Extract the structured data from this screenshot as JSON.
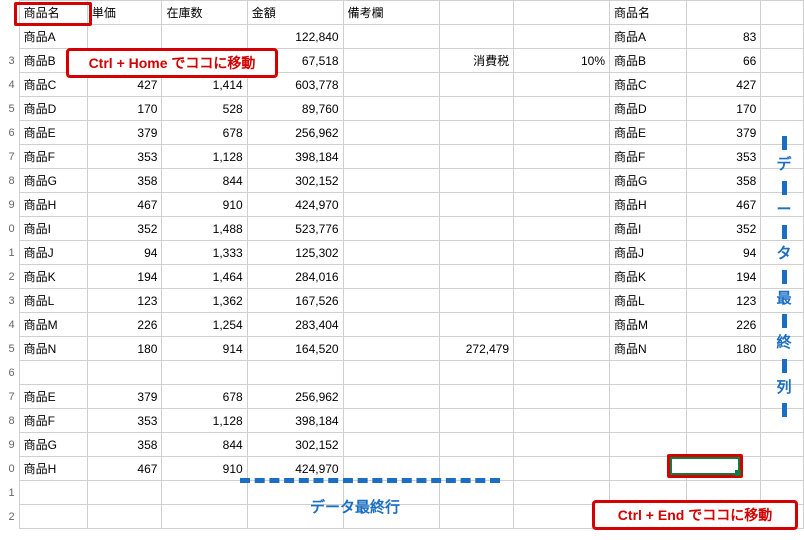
{
  "headers": {
    "name": "商品名",
    "price": "単価",
    "stock": "在庫数",
    "amount": "金額",
    "note": "備考欄",
    "name2": "商品名"
  },
  "rows": [
    {
      "rn": "",
      "name": "商品A",
      "price": "",
      "stock": "",
      "amount": "122,840",
      "note": "",
      "f": "",
      "g": "",
      "name2": "商品A",
      "val": "83"
    },
    {
      "rn": "3",
      "name": "商品B",
      "price": "",
      "stock": "",
      "amount": "67,518",
      "note": "",
      "f": "消費税",
      "g": "10%",
      "name2": "商品B",
      "val": "66"
    },
    {
      "rn": "4",
      "name": "商品C",
      "price": "427",
      "stock": "1,414",
      "amount": "603,778",
      "note": "",
      "f": "",
      "g": "",
      "name2": "商品C",
      "val": "427"
    },
    {
      "rn": "5",
      "name": "商品D",
      "price": "170",
      "stock": "528",
      "amount": "89,760",
      "note": "",
      "f": "",
      "g": "",
      "name2": "商品D",
      "val": "170"
    },
    {
      "rn": "6",
      "name": "商品E",
      "price": "379",
      "stock": "678",
      "amount": "256,962",
      "note": "",
      "f": "",
      "g": "",
      "name2": "商品E",
      "val": "379"
    },
    {
      "rn": "7",
      "name": "商品F",
      "price": "353",
      "stock": "1,128",
      "amount": "398,184",
      "note": "",
      "f": "",
      "g": "",
      "name2": "商品F",
      "val": "353"
    },
    {
      "rn": "8",
      "name": "商品G",
      "price": "358",
      "stock": "844",
      "amount": "302,152",
      "note": "",
      "f": "",
      "g": "",
      "name2": "商品G",
      "val": "358"
    },
    {
      "rn": "9",
      "name": "商品H",
      "price": "467",
      "stock": "910",
      "amount": "424,970",
      "note": "",
      "f": "",
      "g": "",
      "name2": "商品H",
      "val": "467"
    },
    {
      "rn": "0",
      "name": "商品I",
      "price": "352",
      "stock": "1,488",
      "amount": "523,776",
      "note": "",
      "f": "",
      "g": "",
      "name2": "商品I",
      "val": "352"
    },
    {
      "rn": "1",
      "name": "商品J",
      "price": "94",
      "stock": "1,333",
      "amount": "125,302",
      "note": "",
      "f": "",
      "g": "",
      "name2": "商品J",
      "val": "94"
    },
    {
      "rn": "2",
      "name": "商品K",
      "price": "194",
      "stock": "1,464",
      "amount": "284,016",
      "note": "",
      "f": "",
      "g": "",
      "name2": "商品K",
      "val": "194"
    },
    {
      "rn": "3",
      "name": "商品L",
      "price": "123",
      "stock": "1,362",
      "amount": "167,526",
      "note": "",
      "f": "",
      "g": "",
      "name2": "商品L",
      "val": "123"
    },
    {
      "rn": "4",
      "name": "商品M",
      "price": "226",
      "stock": "1,254",
      "amount": "283,404",
      "note": "",
      "f": "",
      "g": "",
      "name2": "商品M",
      "val": "226"
    },
    {
      "rn": "5",
      "name": "商品N",
      "price": "180",
      "stock": "914",
      "amount": "164,520",
      "note": "",
      "f": "272,479",
      "g": "",
      "name2": "商品N",
      "val": "180"
    },
    {
      "rn": "6",
      "name": "",
      "price": "",
      "stock": "",
      "amount": "",
      "note": "",
      "f": "",
      "g": "",
      "name2": "",
      "val": ""
    },
    {
      "rn": "7",
      "name": "商品E",
      "price": "379",
      "stock": "678",
      "amount": "256,962",
      "note": "",
      "f": "",
      "g": "",
      "name2": "",
      "val": ""
    },
    {
      "rn": "8",
      "name": "商品F",
      "price": "353",
      "stock": "1,128",
      "amount": "398,184",
      "note": "",
      "f": "",
      "g": "",
      "name2": "",
      "val": ""
    },
    {
      "rn": "9",
      "name": "商品G",
      "price": "358",
      "stock": "844",
      "amount": "302,152",
      "note": "",
      "f": "",
      "g": "",
      "name2": "",
      "val": ""
    },
    {
      "rn": "0",
      "name": "商品H",
      "price": "467",
      "stock": "910",
      "amount": "424,970",
      "note": "",
      "f": "",
      "g": "",
      "name2": "",
      "val": ""
    },
    {
      "rn": "1",
      "name": "",
      "price": "",
      "stock": "",
      "amount": "",
      "note": "",
      "f": "",
      "g": "",
      "name2": "",
      "val": ""
    },
    {
      "rn": "2",
      "name": "",
      "price": "",
      "stock": "",
      "amount": "",
      "note": "",
      "f": "",
      "g": "",
      "name2": "",
      "val": ""
    }
  ],
  "annotations": {
    "ctrl_home": "Ctrl + Home でココに移動",
    "ctrl_end": "Ctrl + End でココに移動",
    "last_row": "データ最終行",
    "last_col": "データ最終列"
  }
}
